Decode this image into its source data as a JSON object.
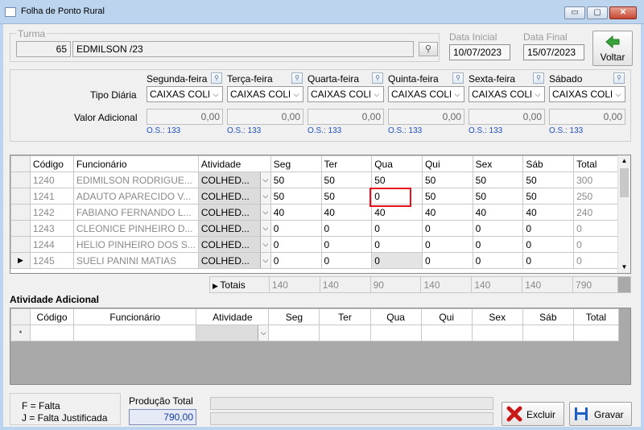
{
  "window": {
    "title": "Folha de Ponto Rural",
    "minimize": "▭",
    "maximize": "▢",
    "close": "✕"
  },
  "turma": {
    "label": "Turma",
    "code": "65",
    "name": "EDMILSON /23"
  },
  "dates": {
    "start_label": "Data Inicial",
    "start": "10/07/2023",
    "end_label": "Data Final",
    "end": "15/07/2023"
  },
  "voltar_label": "Voltar",
  "days": {
    "tipo_label": "Tipo Diária",
    "valor_label": "Valor Adicional",
    "items": [
      {
        "name": "Segunda-feira",
        "tipo": "CAIXAS COLH",
        "valor": "0,00",
        "os": "O.S.: 133"
      },
      {
        "name": "Terça-feira",
        "tipo": "CAIXAS COLH",
        "valor": "0,00",
        "os": "O.S.: 133"
      },
      {
        "name": "Quarta-feira",
        "tipo": "CAIXAS COLH",
        "valor": "0,00",
        "os": "O.S.: 133"
      },
      {
        "name": "Quinta-feira",
        "tipo": "CAIXAS COLH",
        "valor": "0,00",
        "os": "O.S.: 133"
      },
      {
        "name": "Sexta-feira",
        "tipo": "CAIXAS COLH",
        "valor": "0,00",
        "os": "O.S.: 133"
      },
      {
        "name": "Sábado",
        "tipo": "CAIXAS COLH",
        "valor": "0,00",
        "os": "O.S.: 133"
      }
    ]
  },
  "grid": {
    "headers": [
      "Código",
      "Funcionário",
      "Atividade",
      "Seg",
      "Ter",
      "Qua",
      "Qui",
      "Sex",
      "Sáb",
      "Total"
    ],
    "rows": [
      {
        "codigo": "1240",
        "func": "EDIMILSON RODRIGUE...",
        "ativ": "COLHED...",
        "seg": "50",
        "ter": "50",
        "qua": "50",
        "qui": "50",
        "sex": "50",
        "sab": "50",
        "total": "300"
      },
      {
        "codigo": "1241",
        "func": "ADAUTO APARECIDO V...",
        "ativ": "COLHED...",
        "seg": "50",
        "ter": "50",
        "qua": "0",
        "qui": "50",
        "sex": "50",
        "sab": "50",
        "total": "250"
      },
      {
        "codigo": "1242",
        "func": "FABIANO FERNANDO L...",
        "ativ": "COLHED...",
        "seg": "40",
        "ter": "40",
        "qua": "40",
        "qui": "40",
        "sex": "40",
        "sab": "40",
        "total": "240"
      },
      {
        "codigo": "1243",
        "func": "CLEONICE PINHEIRO D...",
        "ativ": "COLHED...",
        "seg": "0",
        "ter": "0",
        "qua": "0",
        "qui": "0",
        "sex": "0",
        "sab": "0",
        "total": "0"
      },
      {
        "codigo": "1244",
        "func": "HELIO PINHEIRO DOS S...",
        "ativ": "COLHED...",
        "seg": "0",
        "ter": "0",
        "qua": "0",
        "qui": "0",
        "sex": "0",
        "sab": "0",
        "total": "0"
      },
      {
        "codigo": "1245",
        "func": "SUELI PANINI MATIAS",
        "ativ": "COLHED...",
        "seg": "0",
        "ter": "0",
        "qua": "0",
        "qui": "0",
        "sex": "0",
        "sab": "0",
        "total": "0"
      }
    ],
    "current_marker": "▶"
  },
  "totals": {
    "label": "Totais",
    "seg": "140",
    "ter": "140",
    "qua": "90",
    "qui": "140",
    "sex": "140",
    "sab": "140",
    "total": "790"
  },
  "adicional": {
    "title": "Atividade Adicional",
    "headers": [
      "Código",
      "Funcionário",
      "Atividade",
      "Seg",
      "Ter",
      "Qua",
      "Qui",
      "Sex",
      "Sáb",
      "Total"
    ],
    "new_marker": "*"
  },
  "legend": {
    "f": "F = Falta",
    "j": "J = Falta Justificada"
  },
  "producao": {
    "label": "Produção Total",
    "value": "790,00"
  },
  "excluir_label": "Excluir",
  "gravar_label": "Gravar",
  "colors": {
    "highlight": "#e8101a",
    "link": "#1f4fbf"
  }
}
